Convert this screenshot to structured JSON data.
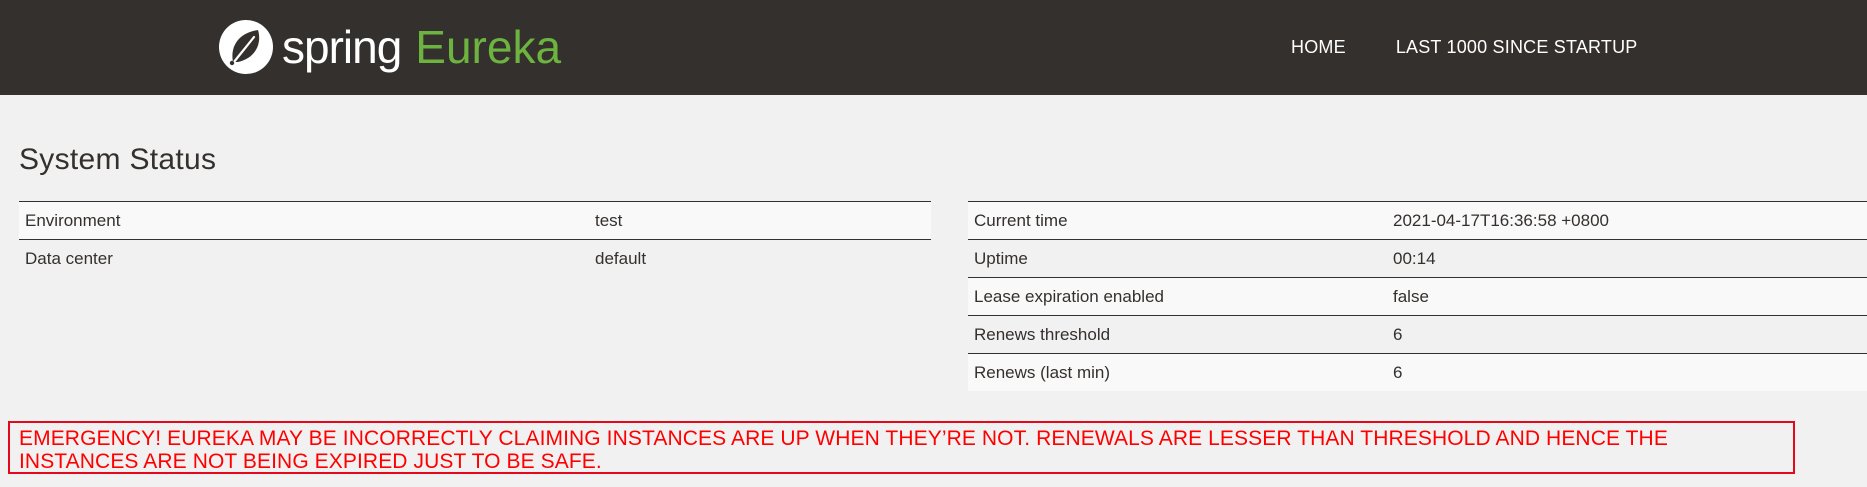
{
  "navbar": {
    "brand_spring": "spring",
    "brand_eureka": "Eureka",
    "links": [
      "HOME",
      "LAST 1000 SINCE STARTUP"
    ]
  },
  "page": {
    "title": "System Status"
  },
  "system_status_left": [
    {
      "key": "Environment",
      "value": "test"
    },
    {
      "key": "Data center",
      "value": "default"
    }
  ],
  "system_status_right": [
    {
      "key": "Current time",
      "value": "2021-04-17T16:36:58 +0800"
    },
    {
      "key": "Uptime",
      "value": "00:14"
    },
    {
      "key": "Lease expiration enabled",
      "value": "false"
    },
    {
      "key": "Renews threshold",
      "value": "6"
    },
    {
      "key": "Renews (last min)",
      "value": "6"
    }
  ],
  "emergency": {
    "message": "EMERGENCY! EUREKA MAY BE INCORRECTLY CLAIMING INSTANCES ARE UP WHEN THEY’RE NOT. RENEWALS ARE LESSER THAN THRESHOLD AND HENCE THE INSTANCES ARE NOT BEING EXPIRED JUST TO BE SAFE."
  },
  "colors": {
    "navbar_bg": "#34302d",
    "brand_green": "#6db33f",
    "page_bg": "#f1f1f1",
    "alert_red": "#ff0000"
  },
  "icons": {
    "logo": "spring-leaf-icon"
  }
}
